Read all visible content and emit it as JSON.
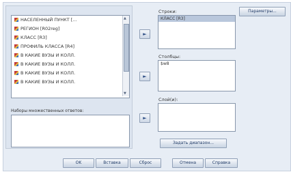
{
  "variables": [
    "НАСЕЛЕННЫЙ ПУНКТ [...",
    "РЕГИОН [R02reg]",
    "КЛАСС [R3]",
    "ПРОФИЛЬ КЛАССА [R4]",
    "В КАКИЕ ВУЗЫ И КОЛЛ.",
    "В КАКИЕ ВУЗЫ И КОЛЛ.",
    "В КАКИЕ ВУЗЫ И КОЛЛ.",
    "В КАКИЕ ВУЗЫ И КОЛЛ."
  ],
  "multiple_response_label": "Наборы множественных ответов:",
  "rows": {
    "label": "Строки:",
    "item": "КЛАСС [R3]"
  },
  "columns": {
    "label": "Столбцы:",
    "item": "$w8"
  },
  "layers": {
    "label": "Слой(и):"
  },
  "arrow_glyph": "►",
  "buttons": {
    "parameters": "Параметры...",
    "define_ranges": "Задать диапазон...",
    "ok": "OK",
    "paste": "Вставка",
    "reset": "Сброс",
    "cancel": "Отмена",
    "help": "Справка"
  }
}
